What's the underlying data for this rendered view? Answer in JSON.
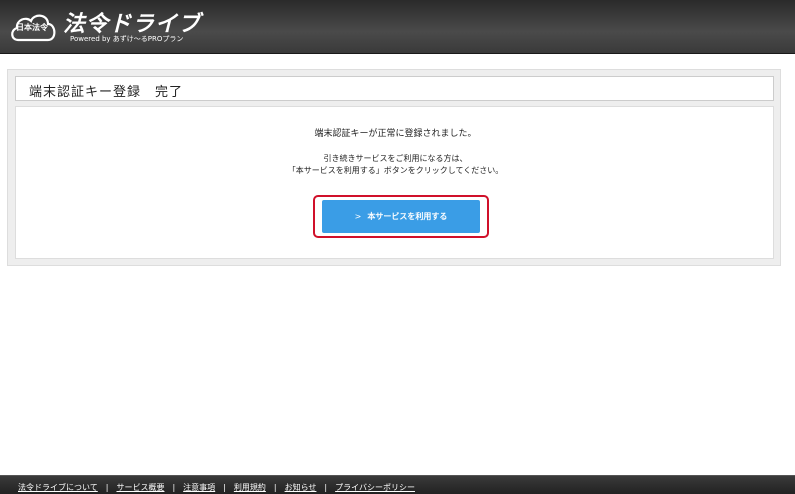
{
  "header": {
    "cloud_label": "日本法令",
    "app_title": "法令ドライブ",
    "powered_by": "Powered by あずけ〜るPROプラン"
  },
  "page": {
    "title": "端末認証キー登録　完了",
    "message_main": "端末認証キーが正常に登録されました。",
    "message_line1": "引き続きサービスをご利用になる方は、",
    "message_line2": "「本サービスを利用する」ボタンをクリックしてください。",
    "button_label": "本サービスを利用する",
    "button_chevron": ">"
  },
  "footer": {
    "links": [
      "法令ドライブについて",
      "サービス概要",
      "注意事項",
      "利用規約",
      "お知らせ",
      "プライバシーポリシー"
    ],
    "separator": "|"
  },
  "colors": {
    "header_bg": "#3a3a3a",
    "button_bg": "#3a9de6",
    "highlight_border": "#d0102a",
    "footer_bg": "#2a2a2a"
  }
}
